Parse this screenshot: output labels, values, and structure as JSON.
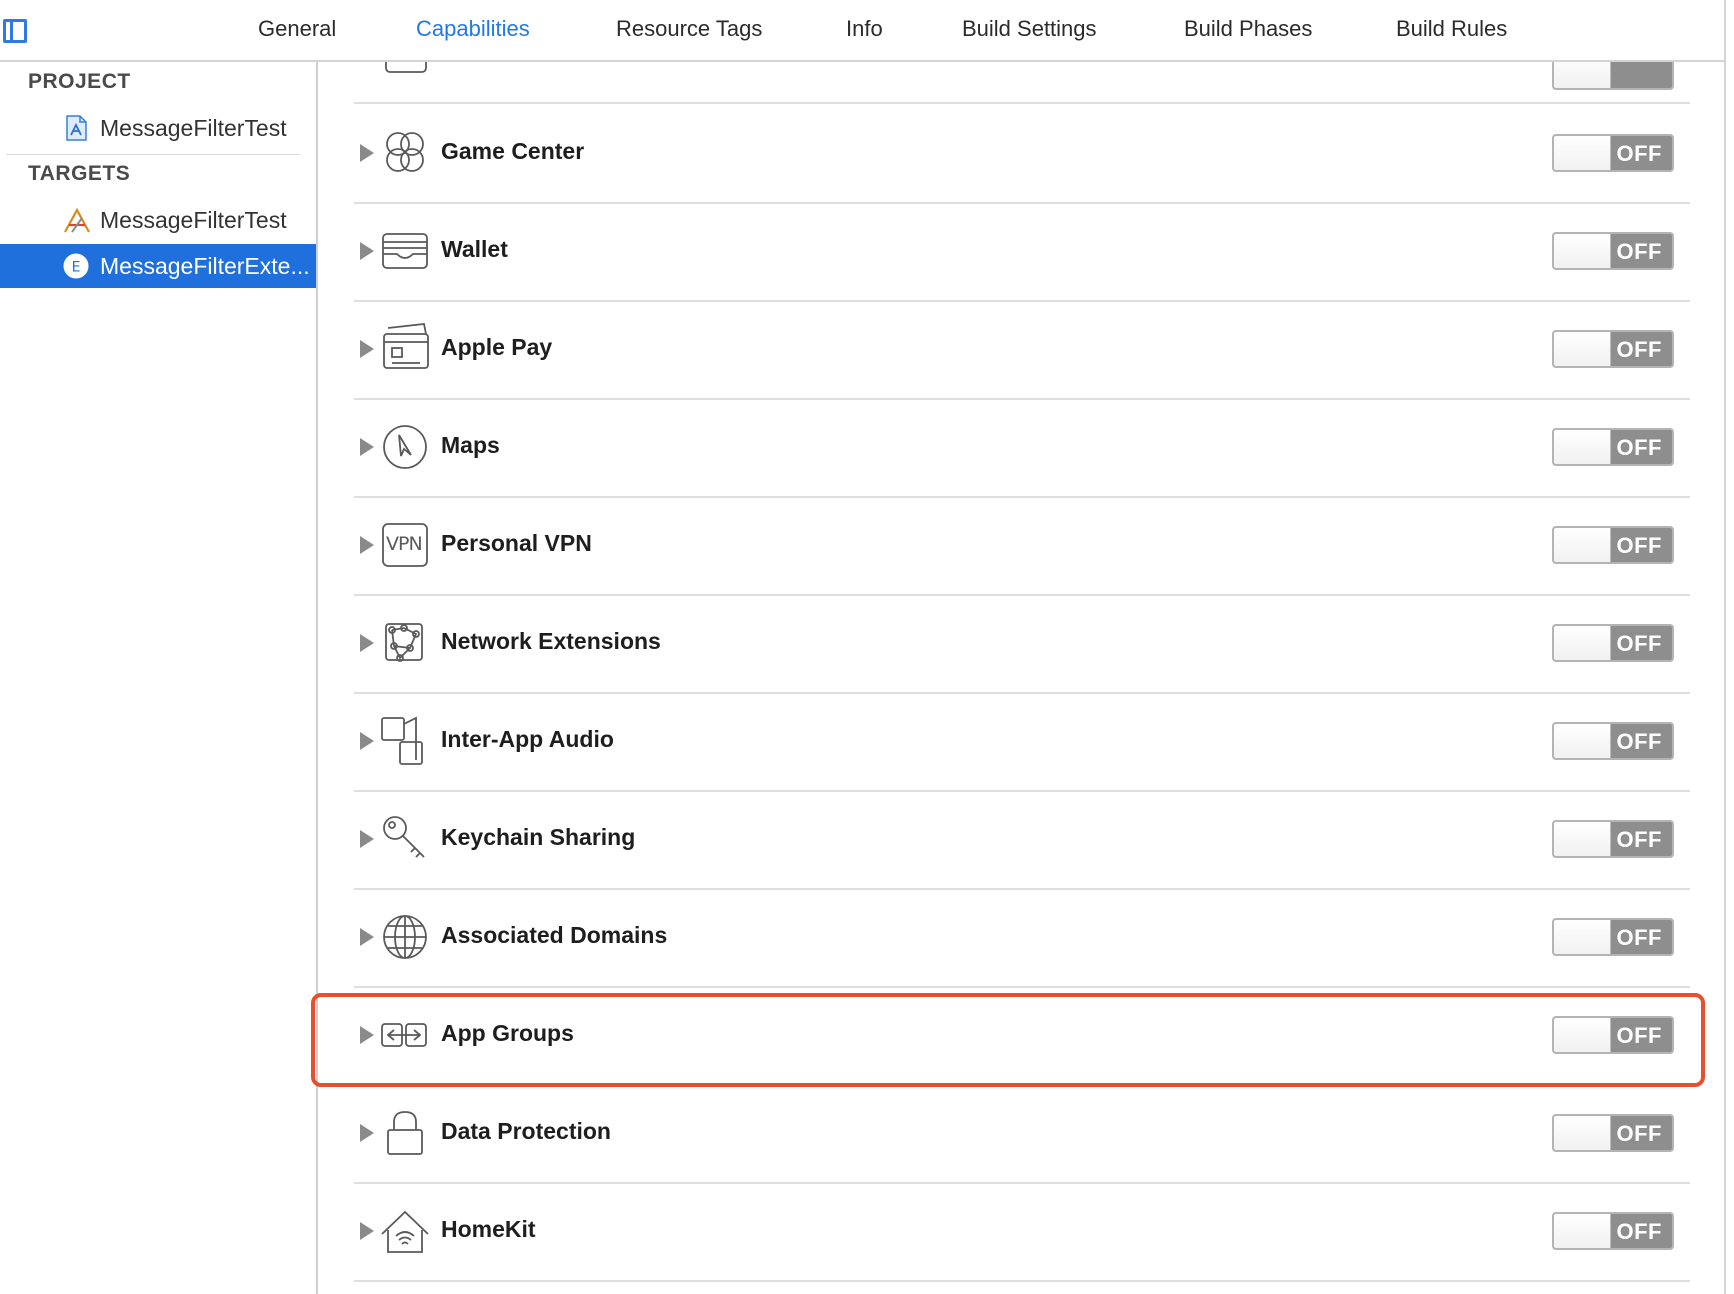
{
  "tabs": [
    {
      "label": "General",
      "active": false
    },
    {
      "label": "Capabilities",
      "active": true
    },
    {
      "label": "Resource Tags",
      "active": false
    },
    {
      "label": "Info",
      "active": false
    },
    {
      "label": "Build Settings",
      "active": false
    },
    {
      "label": "Build Phases",
      "active": false
    },
    {
      "label": "Build Rules",
      "active": false
    }
  ],
  "sidebar": {
    "project_header": "PROJECT",
    "targets_header": "TARGETS",
    "project_items": [
      {
        "label": "MessageFilterTest",
        "icon": "project-file-icon"
      }
    ],
    "target_items": [
      {
        "label": "MessageFilterTest",
        "icon": "app-target-icon",
        "selected": false
      },
      {
        "label": "MessageFilterExte...",
        "icon": "extension-icon",
        "selected": true
      }
    ]
  },
  "capabilities": [
    {
      "label": "Game Center",
      "icon": "game-center-icon",
      "state": "OFF"
    },
    {
      "label": "Wallet",
      "icon": "wallet-icon",
      "state": "OFF"
    },
    {
      "label": "Apple Pay",
      "icon": "apple-pay-icon",
      "state": "OFF"
    },
    {
      "label": "Maps",
      "icon": "maps-icon",
      "state": "OFF"
    },
    {
      "label": "Personal VPN",
      "icon": "vpn-icon",
      "icon_text": "VPN",
      "state": "OFF"
    },
    {
      "label": "Network Extensions",
      "icon": "network-extensions-icon",
      "state": "OFF"
    },
    {
      "label": "Inter-App Audio",
      "icon": "inter-app-audio-icon",
      "state": "OFF"
    },
    {
      "label": "Keychain Sharing",
      "icon": "keychain-icon",
      "state": "OFF"
    },
    {
      "label": "Associated Domains",
      "icon": "globe-icon",
      "state": "OFF"
    },
    {
      "label": "App Groups",
      "icon": "app-groups-icon",
      "state": "OFF",
      "highlighted": true
    },
    {
      "label": "Data Protection",
      "icon": "lock-icon",
      "state": "OFF"
    },
    {
      "label": "HomeKit",
      "icon": "homekit-icon",
      "state": "OFF"
    }
  ],
  "colors": {
    "accent": "#1f7ae6",
    "selection": "#1f6fdc",
    "highlight": "#e4512f",
    "switch_off": "#8e8e8e"
  }
}
